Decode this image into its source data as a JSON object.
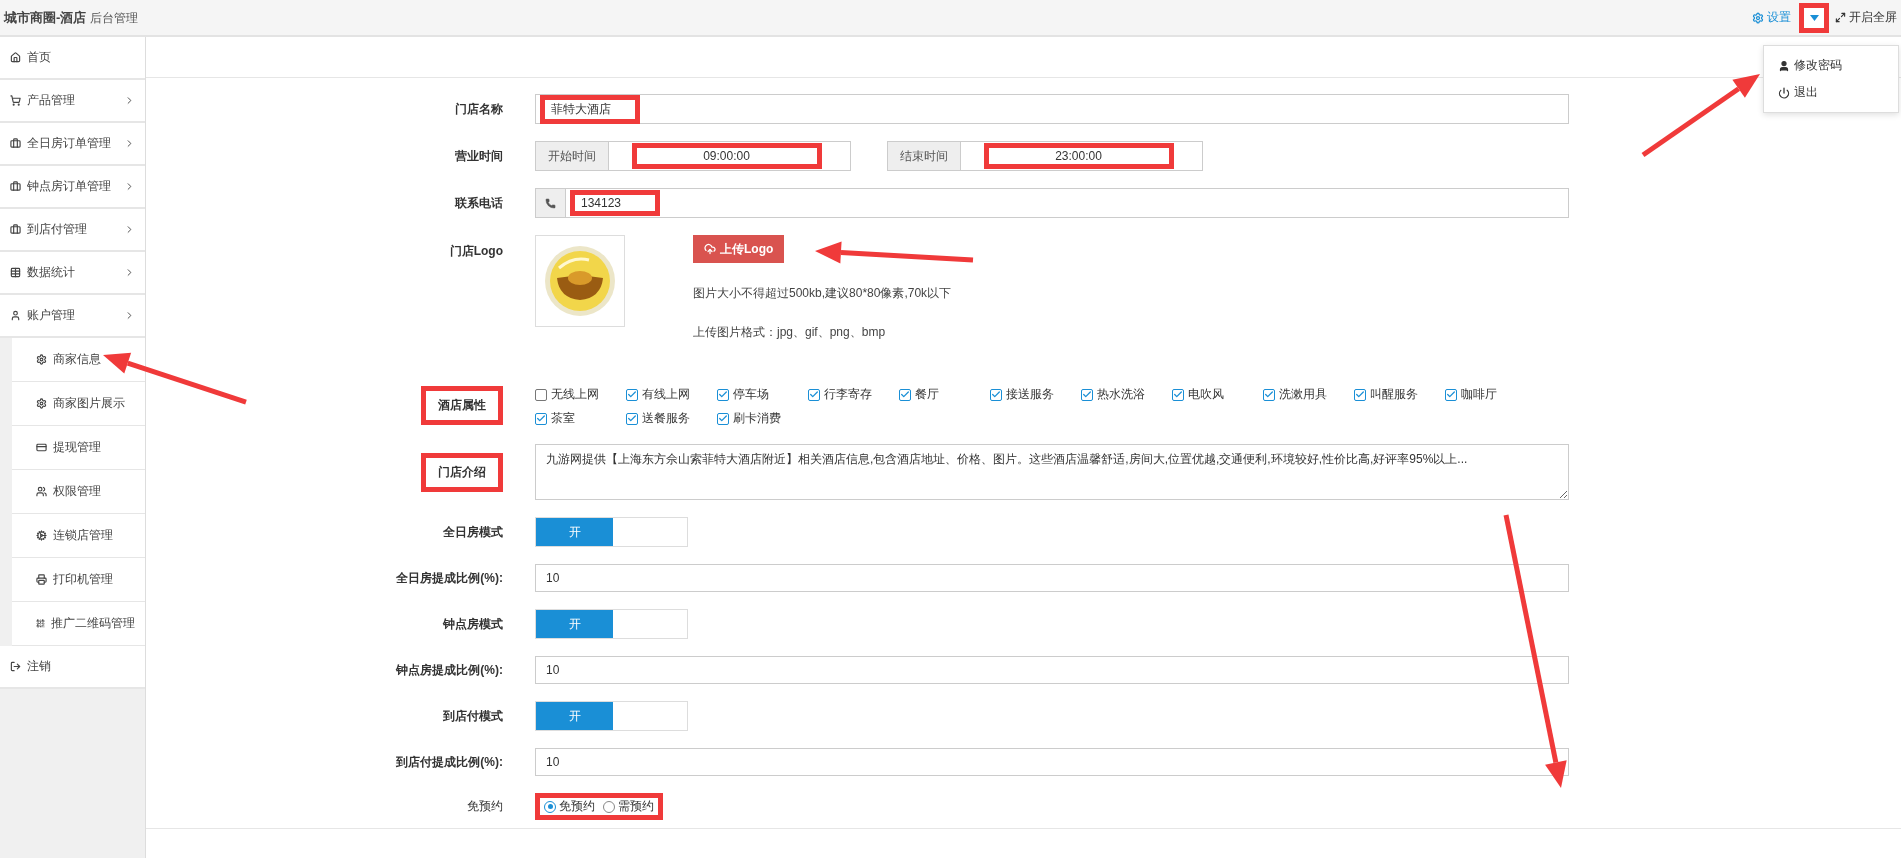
{
  "header": {
    "brand": "城市商圈-酒店",
    "subtitle": "后台管理",
    "settings": "设置",
    "caret_highlighted": true,
    "fullscreen": "开启全屏",
    "menu": {
      "expanded": true,
      "items": [
        "修改密码",
        "退出"
      ]
    }
  },
  "sidebar": {
    "items": [
      {
        "label": "首页"
      },
      {
        "label": "产品管理",
        "has_arrow": true
      },
      {
        "label": "全日房订单管理",
        "has_arrow": true
      },
      {
        "label": "钟点房订单管理",
        "has_arrow": true
      },
      {
        "label": "到店付管理",
        "has_arrow": true
      },
      {
        "label": "数据统计",
        "has_arrow": true
      },
      {
        "label": "账户管理",
        "has_arrow": true,
        "expanded": true,
        "children": [
          {
            "label": "商家信息"
          },
          {
            "label": "商家图片展示"
          },
          {
            "label": "提现管理"
          },
          {
            "label": "权限管理"
          },
          {
            "label": "连锁店管理"
          },
          {
            "label": "打印机管理"
          },
          {
            "label": "推广二维码管理"
          }
        ]
      },
      {
        "label": "注销"
      }
    ]
  },
  "form": [
    {
      "kind": "text",
      "label": "门店名称",
      "value": "菲特大酒店",
      "highlighted": true
    },
    {
      "kind": "time_range",
      "label": "营业时间",
      "start_label": "开始时间",
      "start": "09:00:00",
      "end_label": "结束时间",
      "end": "23:00:00",
      "highlighted": true
    },
    {
      "kind": "phone",
      "label": "联系电话",
      "value": "134123",
      "highlighted": true
    },
    {
      "kind": "logo",
      "label": "门店Logo",
      "button": "上传Logo",
      "notes": [
        "图片大小不得超过500kb,建议80*80像素,70k以下",
        "上传图片格式：jpg、gif、png、bmp"
      ]
    },
    {
      "kind": "checkboxes",
      "label": "酒店属性",
      "label_highlighted": true,
      "options": [
        {
          "label": "无线上网",
          "checked": false
        },
        {
          "label": "有线上网",
          "checked": true
        },
        {
          "label": "停车场",
          "checked": true
        },
        {
          "label": "行李寄存",
          "checked": true
        },
        {
          "label": "餐厅",
          "checked": true
        },
        {
          "label": "接送服务",
          "checked": true
        },
        {
          "label": "热水洗浴",
          "checked": true
        },
        {
          "label": "电吹风",
          "checked": true
        },
        {
          "label": "洗漱用具",
          "checked": true
        },
        {
          "label": "叫醒服务",
          "checked": true
        },
        {
          "label": "咖啡厅",
          "checked": true
        },
        {
          "label": "茶室",
          "checked": true
        },
        {
          "label": "送餐服务",
          "checked": true
        },
        {
          "label": "刷卡消费",
          "checked": true
        }
      ]
    },
    {
      "kind": "textarea",
      "label": "门店介绍",
      "label_highlighted": true,
      "value": "九游网提供【上海东方佘山索菲特大酒店附近】相关酒店信息,包含酒店地址、价格、图片。这些酒店温馨舒适,房间大,位置优越,交通便利,环境较好,性价比高,好评率95%以上..."
    },
    {
      "kind": "switch",
      "label": "全日房模式",
      "on_label": "开",
      "on": true
    },
    {
      "kind": "number",
      "label": "全日房提成比例(%):",
      "value": "10"
    },
    {
      "kind": "switch",
      "label": "钟点房模式",
      "on_label": "开",
      "on": true
    },
    {
      "kind": "number",
      "label": "钟点房提成比例(%):",
      "value": "10"
    },
    {
      "kind": "switch",
      "label": "到店付模式",
      "on_label": "开",
      "on": true
    },
    {
      "kind": "number",
      "label": "到店付提成比例(%):",
      "value": "10"
    },
    {
      "kind": "radio",
      "label": "免预约",
      "highlighted": true,
      "options": [
        {
          "label": "免预约",
          "selected": true
        },
        {
          "label": "需预约",
          "selected": false
        }
      ]
    }
  ]
}
